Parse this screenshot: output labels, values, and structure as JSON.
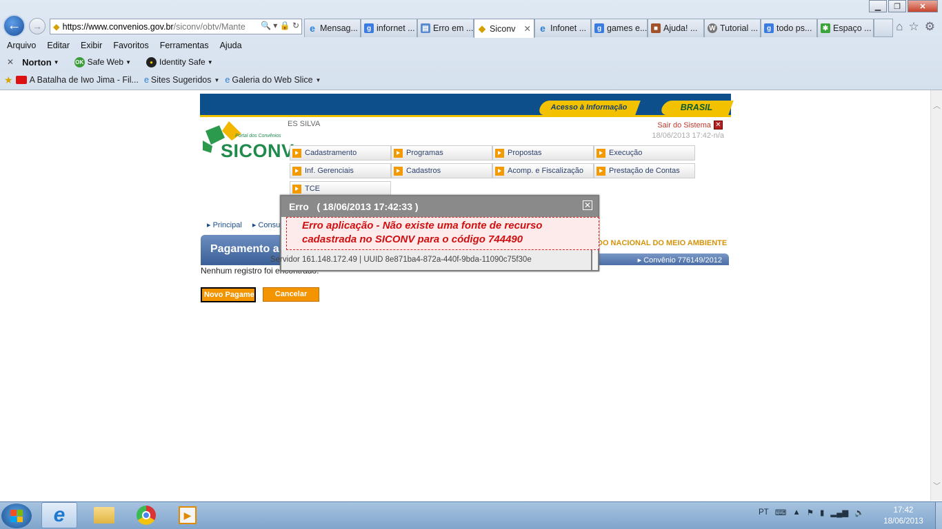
{
  "browser": {
    "url_scheme": "https://",
    "url_host": "www.convenios.gov.br",
    "url_path": "/siconv/obtv/Mante",
    "url_tail": "🔍 ▾ 🔒 ↻",
    "tabs": [
      {
        "label": "Mensag...",
        "icon": "ie-icon"
      },
      {
        "label": "infornet ...",
        "icon": "google-icon"
      },
      {
        "label": "Erro em ...",
        "icon": "page-icon"
      },
      {
        "label": "Siconv",
        "icon": "siconv-icon",
        "active": true
      },
      {
        "label": "Infonet ...",
        "icon": "ie-icon"
      },
      {
        "label": "games e...",
        "icon": "google-icon"
      },
      {
        "label": "Ajuda! ...",
        "icon": "box-icon"
      },
      {
        "label": "Tutorial ...",
        "icon": "wordpress-icon"
      },
      {
        "label": "todo ps...",
        "icon": "google-icon"
      },
      {
        "label": "Espaço ...",
        "icon": "green-icon"
      }
    ],
    "menu": [
      "Arquivo",
      "Editar",
      "Exibir",
      "Favoritos",
      "Ferramentas",
      "Ajuda"
    ],
    "norton": {
      "brand": "Norton",
      "safe_web": "Safe Web",
      "identity_safe": "Identity Safe"
    },
    "favorites": {
      "item1": "A Batalha de Iwo Jima - Fil...",
      "item2": "Sites Sugeridos",
      "item3": "Galeria do Web Slice"
    }
  },
  "site": {
    "banner_acesso": "Acesso à Informação",
    "banner_brasil": "BRASIL",
    "logo_subtitle": "Portal dos Convênios",
    "logo_title": "SICONV",
    "user_name": "ES SILVA",
    "logout_label": "Sair do Sistema",
    "datetime": "18/06/2013 17:42-n/a",
    "menu": [
      "Cadastramento",
      "Programas",
      "Propostas",
      "Execução",
      "Inf. Gerenciais",
      "Cadastros",
      "Acomp. e Fiscalização",
      "Prestação de Contas",
      "TCE"
    ],
    "breadcrumb": [
      "Principal",
      "Consultar"
    ],
    "page_title": "Pagamento a",
    "org_name": "DO NACIONAL DO MEIO AMBIENTE",
    "convenio": "Convênio 776149/2012",
    "no_records": "Nenhum registro foi encontrado.",
    "btn_new": "Novo Pagame",
    "btn_cancel": "Cancelar"
  },
  "dialog": {
    "title": "Erro   ( 18/06/2013 17:42:33 )",
    "message_line1": "Erro aplicação - Não existe uma fonte de recurso",
    "message_line2": "cadastrada no SICONV para o código 744490",
    "footer": "Servidor 161.148.172.49 | UUID 8e871ba4-872a-440f-9bda-11090c75f30e"
  },
  "taskbar": {
    "lang": "PT",
    "time": "17:42",
    "date": "18/06/2013"
  }
}
